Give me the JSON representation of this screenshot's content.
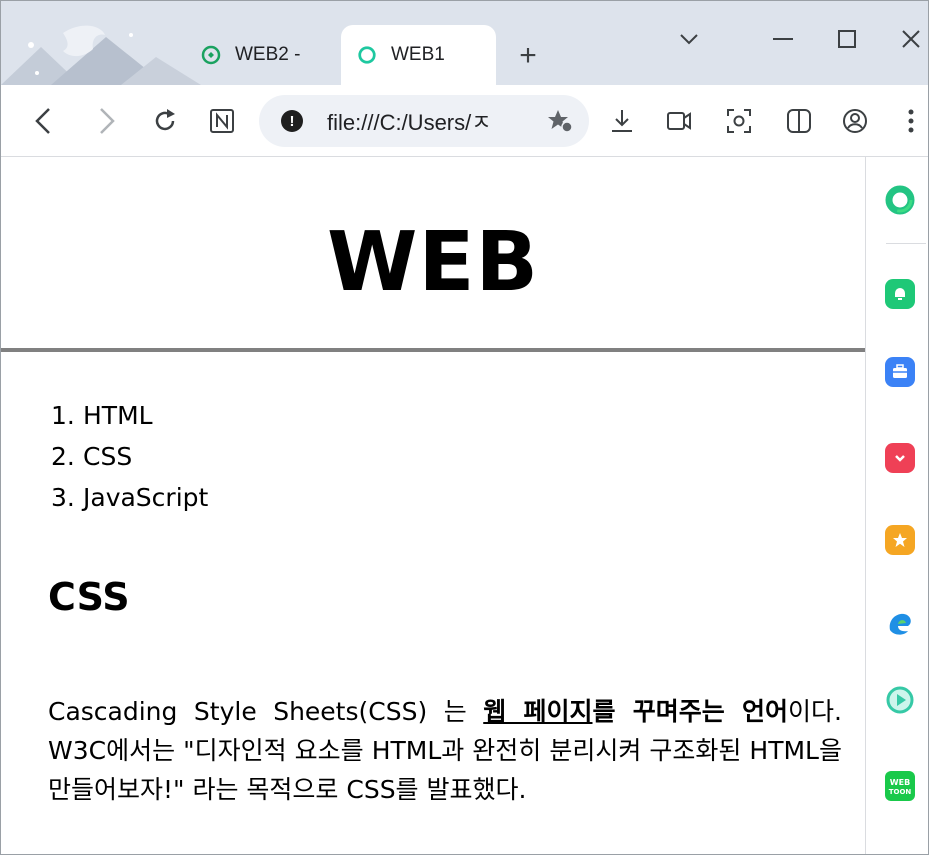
{
  "browser": {
    "tabs": [
      {
        "label": "WEB2 -",
        "active": false
      },
      {
        "label": "WEB1",
        "active": true
      }
    ],
    "new_tab_label": "+",
    "address": "file:///C:/Users/ㅈ",
    "colors": {
      "tabstrip": "#dde3ec",
      "accent": "#1aa260"
    }
  },
  "page": {
    "title": "WEB",
    "nav": [
      {
        "num": "1.",
        "label": "HTML"
      },
      {
        "num": "2.",
        "label": "CSS"
      },
      {
        "num": "3.",
        "label": "JavaScript"
      }
    ],
    "section_title": "CSS",
    "paragraph": {
      "prefix": "Cascading Style Sheets(CSS) 는 ",
      "link": "웹 페이지",
      "bold": "를 꾸며주는 언어",
      "suffix": "이다. W3C에서는 \"디자인적 요소를 HTML과 완전히 분리시켜 구조화된 HTML을 만들어보자!\" 라는 목적으로 CSS를 발표했다."
    }
  },
  "side_panel": {
    "icons": [
      "green-ring-icon",
      "chat-bell-icon",
      "briefcase-icon",
      "pocket-icon",
      "star-icon",
      "edge-games-icon",
      "play-icon",
      "webtoon-icon"
    ]
  }
}
